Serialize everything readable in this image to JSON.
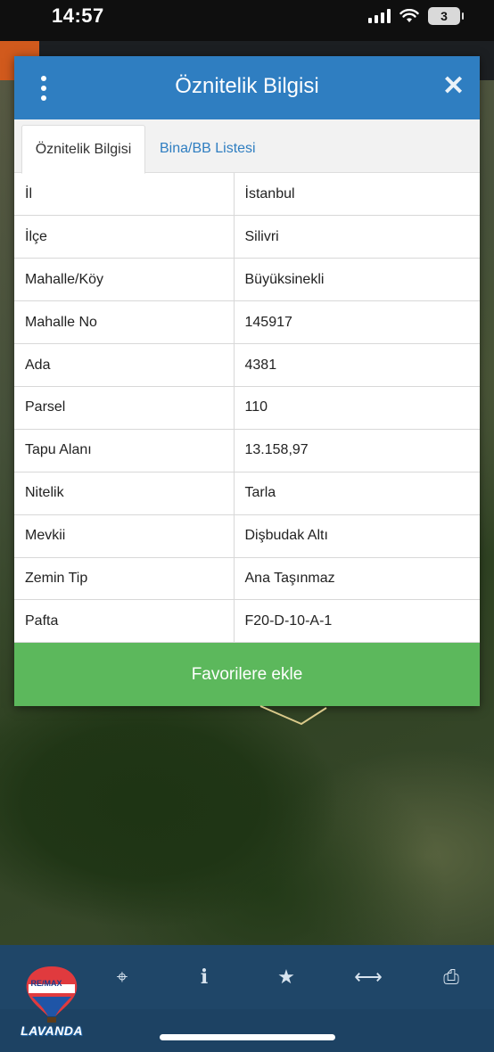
{
  "status_bar": {
    "time": "14:57",
    "battery": "3"
  },
  "dialog": {
    "title": "Öznitelik Bilgisi",
    "menu_icon": "kebab-menu-icon",
    "close_icon": "close-icon",
    "tabs": [
      {
        "label": "Öznitelik Bilgisi",
        "active": true
      },
      {
        "label": "Bina/BB Listesi",
        "active": false
      }
    ],
    "rows": [
      {
        "key": "İl",
        "value": "İstanbul"
      },
      {
        "key": "İlçe",
        "value": "Silivri"
      },
      {
        "key": "Mahalle/Köy",
        "value": "Büyüksinekli"
      },
      {
        "key": "Mahalle No",
        "value": "145917"
      },
      {
        "key": "Ada",
        "value": "4381"
      },
      {
        "key": "Parsel",
        "value": "110"
      },
      {
        "key": "Tapu Alanı",
        "value": "13.158,97"
      },
      {
        "key": "Nitelik",
        "value": "Tarla"
      },
      {
        "key": "Mevkii",
        "value": "Dişbudak Altı"
      },
      {
        "key": "Zemin Tip",
        "value": "Ana Taşınmaz"
      },
      {
        "key": "Pafta",
        "value": "F20-D-10-A-1"
      }
    ],
    "favorite_button": "Favorilere ekle"
  },
  "toolbar": {
    "logo_text": "LAVANDA",
    "logo_balloon_text": "RE/MAX",
    "tools": [
      {
        "name": "locate-icon",
        "glyph": "⌖"
      },
      {
        "name": "info-icon",
        "glyph": "i"
      },
      {
        "name": "star-icon",
        "glyph": "★"
      },
      {
        "name": "measure-icon",
        "glyph": "⟷"
      },
      {
        "name": "print-icon",
        "glyph": "⎙"
      }
    ]
  },
  "colors": {
    "header_blue": "#2f7ec1",
    "button_green": "#5cb85c",
    "toolbar_navy": "#1f4668",
    "orange_accent": "#d15a1d"
  }
}
